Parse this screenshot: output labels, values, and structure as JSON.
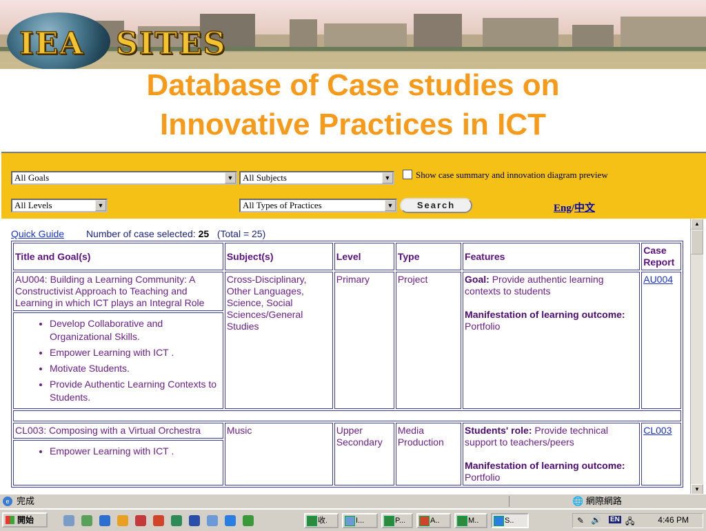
{
  "banner": {
    "logo_left": "IEA",
    "logo_right": "SITES"
  },
  "title": {
    "line1": "Database of Case studies on",
    "line2": "Innovative Practices in ICT"
  },
  "filters": {
    "goals": "All Goals",
    "subjects": "All Subjects",
    "levels": "All Levels",
    "practices": "All Types of Practices",
    "show_summary_label": "Show case summary and innovation diagram preview",
    "search_label": "Search",
    "lang_eng": "Eng",
    "lang_sep": "/",
    "lang_zh": "中文"
  },
  "summary": {
    "quick_guide": "Quick Guide",
    "selected_label": "Number of case selected:",
    "selected_count": "25",
    "total": "(Total = 25)"
  },
  "table": {
    "headers": [
      "Title and Goal(s)",
      "Subject(s)",
      "Level",
      "Type",
      "Features",
      "Case Report"
    ],
    "rows": [
      {
        "title": "AU004: Building a Learning Community: A Constructivist Approach to Teaching and Learning in which ICT plays an Integral Role",
        "goals": [
          "Develop Collaborative and Organizational Skills.",
          "Empower Learning with ICT .",
          "Motivate Students.",
          "Provide Authentic Learning Contexts to Students."
        ],
        "subjects": "Cross-Disciplinary, Other Languages, Science, Social Sciences/General Studies",
        "level": "Primary",
        "type": "Project",
        "feature1_label": "Goal:",
        "feature1_text": "Provide authentic learning contexts to students",
        "feature2_label": "Manifestation of learning outcome:",
        "feature2_text": "Portfolio",
        "report": "AU004"
      },
      {
        "title": "CL003: Composing with a Virtual Orchestra",
        "goals": [
          "Empower Learning with ICT ."
        ],
        "subjects": "Music",
        "level": "Upper Secondary",
        "type": "Media Production",
        "feature1_label": "Students' role:",
        "feature1_text": "Provide technical support to teachers/peers",
        "feature2_label": "Manifestation of learning outcome:",
        "feature2_text": "Portfolio",
        "report": "CL003"
      }
    ]
  },
  "statusbar": {
    "text": "完成",
    "zone": "網際網路"
  },
  "taskbar": {
    "start": "開始",
    "buttons": [
      "收.",
      "I...",
      "P...",
      "A..",
      "M..",
      "S.."
    ],
    "ime": "EN",
    "time": "4:46 PM"
  },
  "colors": {
    "title": "#f79a1a",
    "filterbar": "#f5c116",
    "table_text": "#6b1f8a",
    "link": "#1a33cc"
  }
}
